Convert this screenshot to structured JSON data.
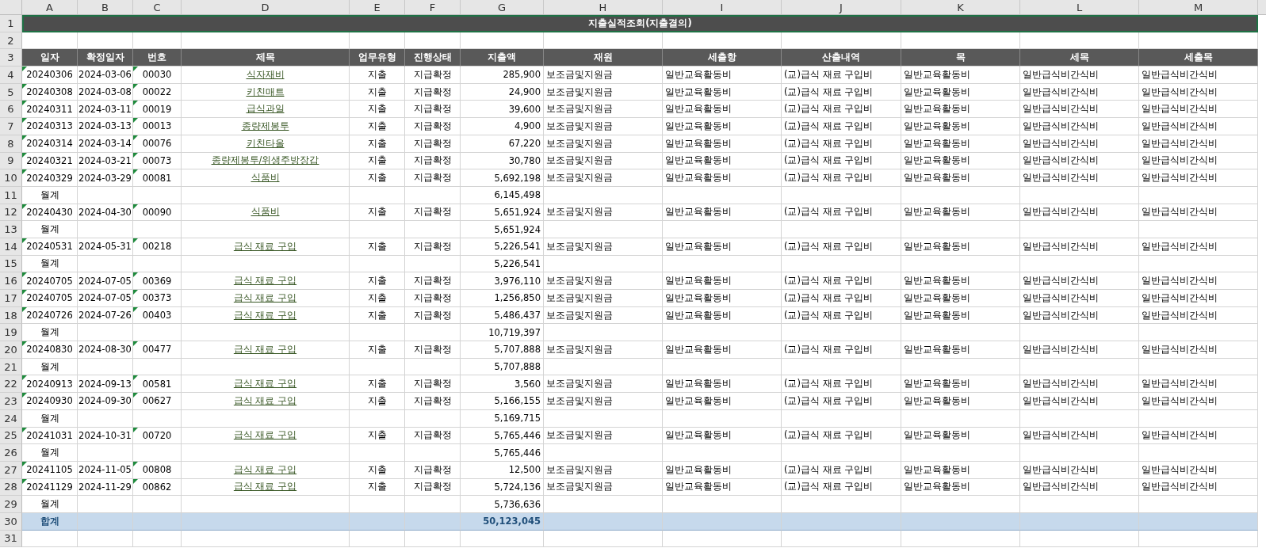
{
  "sheet": {
    "columns": [
      "A",
      "B",
      "C",
      "D",
      "E",
      "F",
      "G",
      "H",
      "I",
      "J",
      "K",
      "L",
      "M"
    ],
    "rows": [
      {
        "row": "1",
        "kind": "title",
        "text": "지출실적조회(지출결의)",
        "selected": true
      },
      {
        "row": "2",
        "kind": "blank"
      },
      {
        "row": "3",
        "kind": "header",
        "cells": [
          "일자",
          "확정일자",
          "번호",
          "제목",
          "업무유형",
          "진행상태",
          "지출액",
          "재원",
          "세출항",
          "산출내역",
          "목",
          "세목",
          "세출목"
        ]
      },
      {
        "row": "4",
        "kind": "entry",
        "flagged": true,
        "cells": [
          "20240306",
          "2024-03-06",
          "00030",
          "식자재비",
          "지출",
          "지급확정",
          "285,900",
          "보조금및지원금",
          "일반교육활동비",
          "(교)급식 재료 구입비",
          "일반교육활동비",
          "일반급식비간식비",
          "일반급식비간식비"
        ]
      },
      {
        "row": "5",
        "kind": "entry",
        "flagged": true,
        "cells": [
          "20240308",
          "2024-03-08",
          "00022",
          "키친매트",
          "지출",
          "지급확정",
          "24,900",
          "보조금및지원금",
          "일반교육활동비",
          "(교)급식 재료 구입비",
          "일반교육활동비",
          "일반급식비간식비",
          "일반급식비간식비"
        ]
      },
      {
        "row": "6",
        "kind": "entry",
        "flagged": true,
        "cells": [
          "20240311",
          "2024-03-11",
          "00019",
          "급식과일",
          "지출",
          "지급확정",
          "39,600",
          "보조금및지원금",
          "일반교육활동비",
          "(교)급식 재료 구입비",
          "일반교육활동비",
          "일반급식비간식비",
          "일반급식비간식비"
        ]
      },
      {
        "row": "7",
        "kind": "entry",
        "flagged": true,
        "cells": [
          "20240313",
          "2024-03-13",
          "00013",
          "종량제봉투",
          "지출",
          "지급확정",
          "4,900",
          "보조금및지원금",
          "일반교육활동비",
          "(교)급식 재료 구입비",
          "일반교육활동비",
          "일반급식비간식비",
          "일반급식비간식비"
        ]
      },
      {
        "row": "8",
        "kind": "entry",
        "flagged": true,
        "cells": [
          "20240314",
          "2024-03-14",
          "00076",
          "키친타올",
          "지출",
          "지급확정",
          "67,220",
          "보조금및지원금",
          "일반교육활동비",
          "(교)급식 재료 구입비",
          "일반교육활동비",
          "일반급식비간식비",
          "일반급식비간식비"
        ]
      },
      {
        "row": "9",
        "kind": "entry",
        "flagged": true,
        "cells": [
          "20240321",
          "2024-03-21",
          "00073",
          "종량제봉투/위생주방장갑",
          "지출",
          "지급확정",
          "30,780",
          "보조금및지원금",
          "일반교육활동비",
          "(교)급식 재료 구입비",
          "일반교육활동비",
          "일반급식비간식비",
          "일반급식비간식비"
        ]
      },
      {
        "row": "10",
        "kind": "entry",
        "flagged": true,
        "cells": [
          "20240329",
          "2024-03-29",
          "00081",
          "식품비",
          "지출",
          "지급확정",
          "5,692,198",
          "보조금및지원금",
          "일반교육활동비",
          "(교)급식 재료 구입비",
          "일반교육활동비",
          "일반급식비간식비",
          "일반급식비간식비"
        ]
      },
      {
        "row": "11",
        "kind": "subtotal",
        "label": "월계",
        "amount": "6,145,498"
      },
      {
        "row": "12",
        "kind": "entry",
        "flagged": true,
        "cells": [
          "20240430",
          "2024-04-30",
          "00090",
          "식품비",
          "지출",
          "지급확정",
          "5,651,924",
          "보조금및지원금",
          "일반교육활동비",
          "(교)급식 재료 구입비",
          "일반교육활동비",
          "일반급식비간식비",
          "일반급식비간식비"
        ]
      },
      {
        "row": "13",
        "kind": "subtotal",
        "label": "월계",
        "amount": "5,651,924"
      },
      {
        "row": "14",
        "kind": "entry",
        "flagged": true,
        "cells": [
          "20240531",
          "2024-05-31",
          "00218",
          "급식 재료 구입",
          "지출",
          "지급확정",
          "5,226,541",
          "보조금및지원금",
          "일반교육활동비",
          "(교)급식 재료 구입비",
          "일반교육활동비",
          "일반급식비간식비",
          "일반급식비간식비"
        ]
      },
      {
        "row": "15",
        "kind": "subtotal",
        "label": "월계",
        "amount": "5,226,541"
      },
      {
        "row": "16",
        "kind": "entry",
        "flagged": true,
        "cells": [
          "20240705",
          "2024-07-05",
          "00369",
          "급식 재료 구입",
          "지출",
          "지급확정",
          "3,976,110",
          "보조금및지원금",
          "일반교육활동비",
          "(교)급식 재료 구입비",
          "일반교육활동비",
          "일반급식비간식비",
          "일반급식비간식비"
        ]
      },
      {
        "row": "17",
        "kind": "entry",
        "flagged": true,
        "cells": [
          "20240705",
          "2024-07-05",
          "00373",
          "급식 재료 구입",
          "지출",
          "지급확정",
          "1,256,850",
          "보조금및지원금",
          "일반교육활동비",
          "(교)급식 재료 구입비",
          "일반교육활동비",
          "일반급식비간식비",
          "일반급식비간식비"
        ]
      },
      {
        "row": "18",
        "kind": "entry",
        "flagged": true,
        "cells": [
          "20240726",
          "2024-07-26",
          "00403",
          "급식 재료 구입",
          "지출",
          "지급확정",
          "5,486,437",
          "보조금및지원금",
          "일반교육활동비",
          "(교)급식 재료 구입비",
          "일반교육활동비",
          "일반급식비간식비",
          "일반급식비간식비"
        ]
      },
      {
        "row": "19",
        "kind": "subtotal",
        "label": "월계",
        "amount": "10,719,397"
      },
      {
        "row": "20",
        "kind": "entry",
        "flagged": true,
        "cells": [
          "20240830",
          "2024-08-30",
          "00477",
          "급식 재료 구입",
          "지출",
          "지급확정",
          "5,707,888",
          "보조금및지원금",
          "일반교육활동비",
          "(교)급식 재료 구입비",
          "일반교육활동비",
          "일반급식비간식비",
          "일반급식비간식비"
        ]
      },
      {
        "row": "21",
        "kind": "subtotal",
        "label": "월계",
        "amount": "5,707,888"
      },
      {
        "row": "22",
        "kind": "entry",
        "flagged": true,
        "cells": [
          "20240913",
          "2024-09-13",
          "00581",
          "급식 재료 구입",
          "지출",
          "지급확정",
          "3,560",
          "보조금및지원금",
          "일반교육활동비",
          "(교)급식 재료 구입비",
          "일반교육활동비",
          "일반급식비간식비",
          "일반급식비간식비"
        ]
      },
      {
        "row": "23",
        "kind": "entry",
        "flagged": true,
        "cells": [
          "20240930",
          "2024-09-30",
          "00627",
          "급식 재료 구입",
          "지출",
          "지급확정",
          "5,166,155",
          "보조금및지원금",
          "일반교육활동비",
          "(교)급식 재료 구입비",
          "일반교육활동비",
          "일반급식비간식비",
          "일반급식비간식비"
        ]
      },
      {
        "row": "24",
        "kind": "subtotal",
        "label": "월계",
        "amount": "5,169,715"
      },
      {
        "row": "25",
        "kind": "entry",
        "flagged": true,
        "cells": [
          "20241031",
          "2024-10-31",
          "00720",
          "급식 재료 구입",
          "지출",
          "지급확정",
          "5,765,446",
          "보조금및지원금",
          "일반교육활동비",
          "(교)급식 재료 구입비",
          "일반교육활동비",
          "일반급식비간식비",
          "일반급식비간식비"
        ]
      },
      {
        "row": "26",
        "kind": "subtotal",
        "label": "월계",
        "amount": "5,765,446"
      },
      {
        "row": "27",
        "kind": "entry",
        "flagged": true,
        "cells": [
          "20241105",
          "2024-11-05",
          "00808",
          "급식 재료 구입",
          "지출",
          "지급확정",
          "12,500",
          "보조금및지원금",
          "일반교육활동비",
          "(교)급식 재료 구입비",
          "일반교육활동비",
          "일반급식비간식비",
          "일반급식비간식비"
        ]
      },
      {
        "row": "28",
        "kind": "entry",
        "flagged": true,
        "cells": [
          "20241129",
          "2024-11-29",
          "00862",
          "급식 재료 구입",
          "지출",
          "지급확정",
          "5,724,136",
          "보조금및지원금",
          "일반교육활동비",
          "(교)급식 재료 구입비",
          "일반교육활동비",
          "일반급식비간식비",
          "일반급식비간식비"
        ]
      },
      {
        "row": "29",
        "kind": "subtotal",
        "label": "월계",
        "amount": "5,736,636"
      },
      {
        "row": "30",
        "kind": "total",
        "label": "합계",
        "amount": "50,123,045"
      },
      {
        "row": "31",
        "kind": "blank"
      }
    ]
  }
}
